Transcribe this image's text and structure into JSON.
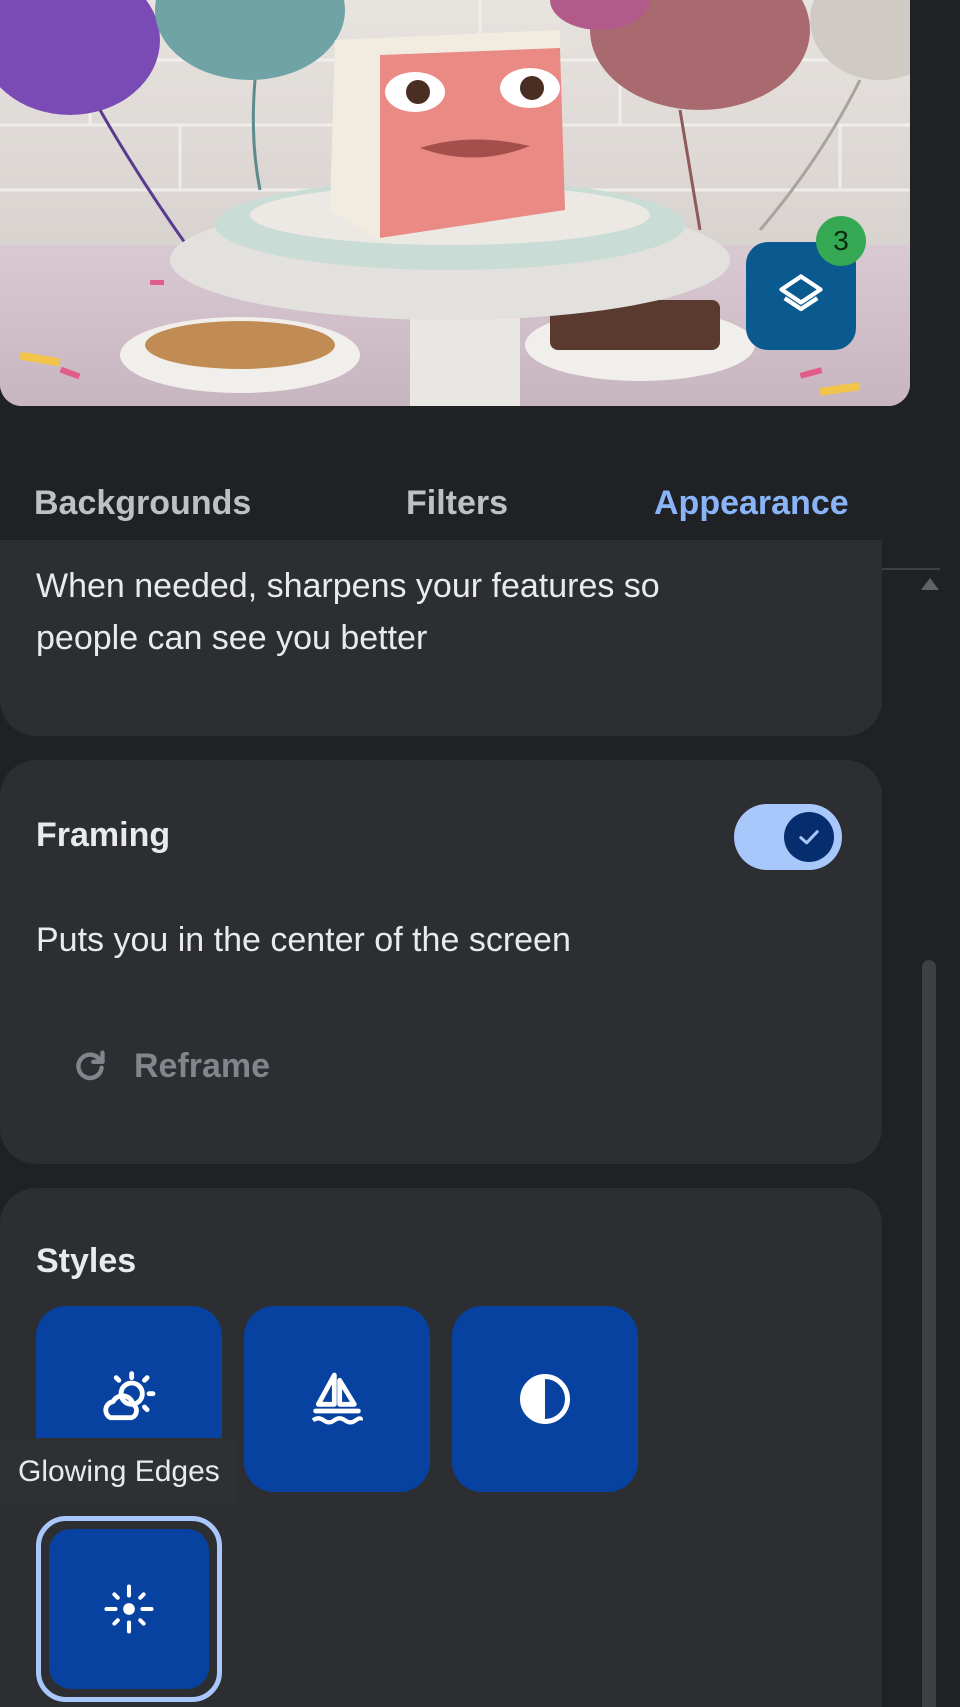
{
  "preview": {
    "effects_badge_count": "3",
    "effects_icon": "layers-icon"
  },
  "tabs": [
    {
      "label": "Backgrounds",
      "selected": false
    },
    {
      "label": "Filters",
      "selected": false
    },
    {
      "label": "Appearance",
      "selected": true
    }
  ],
  "lighting_card": {
    "description_line1": "When needed, sharpens your features so",
    "description_line2": "people can see you better"
  },
  "framing_card": {
    "title": "Framing",
    "toggle_on": true,
    "description": "Puts you in the center of the screen",
    "reframe_label": "Reframe",
    "reframe_icon": "refresh-icon"
  },
  "styles_card": {
    "title": "Styles",
    "tiles": [
      {
        "icon": "light-effect-icon"
      },
      {
        "icon": "sailboat-icon"
      },
      {
        "icon": "contrast-icon"
      },
      {
        "icon": "sparkle-icon",
        "selected": true
      }
    ],
    "tooltip": "Glowing Edges"
  },
  "colors": {
    "background": "#202124",
    "card": "#2d2e31",
    "accent": "#8ab4f8",
    "tile": "#0842a0",
    "badge": "#34a853"
  }
}
